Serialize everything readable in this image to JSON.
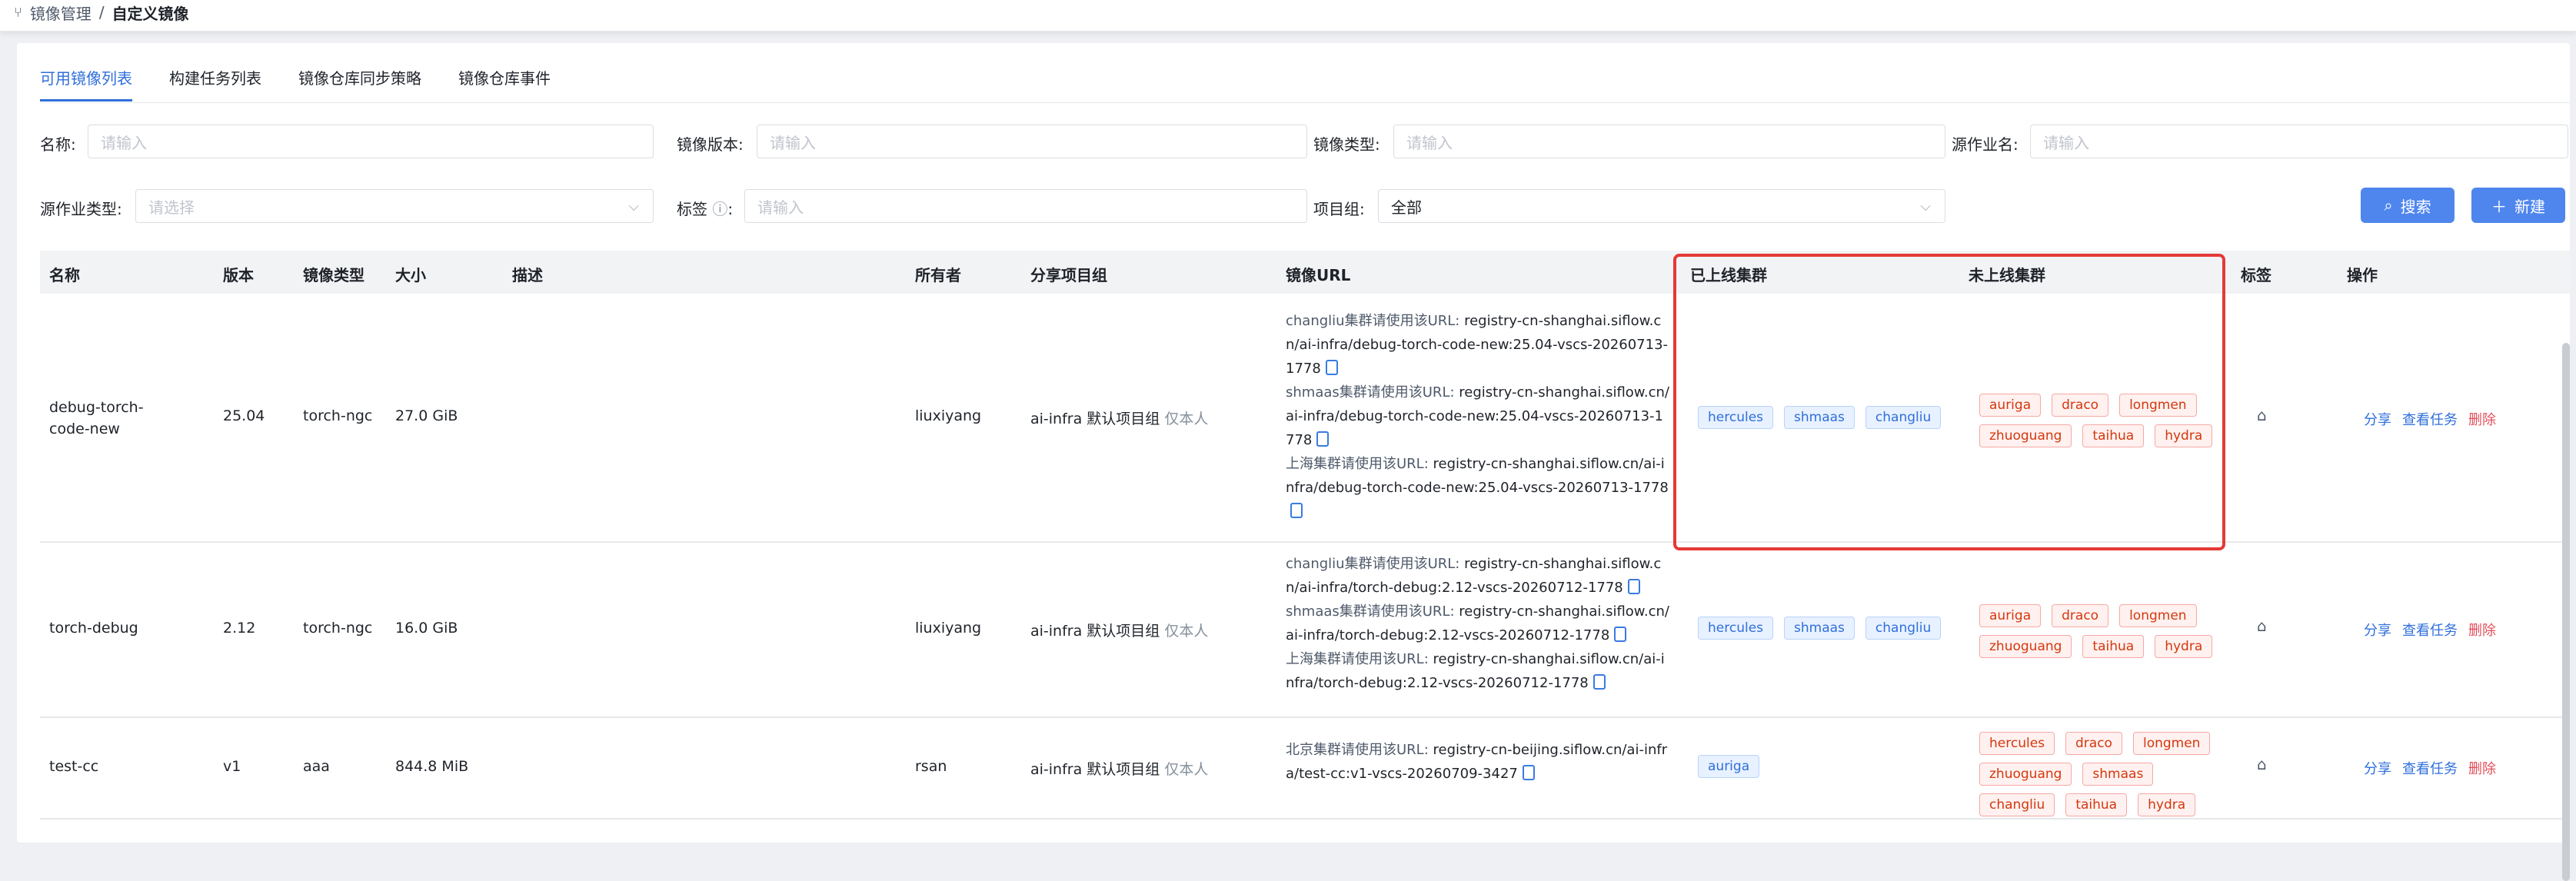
{
  "breadcrumb": {
    "parent": "镜像管理",
    "separator": "/",
    "current": "自定义镜像"
  },
  "tabs": [
    "可用镜像列表",
    "构建任务列表",
    "镜像仓库同步策略",
    "镜像仓库事件"
  ],
  "filters": {
    "name": {
      "label": "名称:",
      "placeholder": "请输入"
    },
    "version": {
      "label": "镜像版本:",
      "placeholder": "请输入"
    },
    "type": {
      "label": "镜像类型:",
      "placeholder": "请输入"
    },
    "source_job": {
      "label": "源作业名:",
      "placeholder": "请输入"
    },
    "source_job_type": {
      "label": "源作业类型:",
      "placeholder": "请选择"
    },
    "tag": {
      "label": "标签",
      "placeholder": "请输入"
    },
    "project": {
      "label": "项目组:",
      "value": "全部"
    }
  },
  "buttons": {
    "search": "搜索",
    "new": "新建"
  },
  "columns": [
    "名称",
    "版本",
    "镜像类型",
    "大小",
    "描述",
    "所有者",
    "分享项目组",
    "镜像URL",
    "已上线集群",
    "未上线集群",
    "标签",
    "操作"
  ],
  "rows": [
    {
      "name": "debug-torch-code-new",
      "version": "25.04",
      "type": "torch-ngc",
      "size": "27.0 GiB",
      "owner": "liuxiyang",
      "group": "ai-infra 默认项目组",
      "group_note": "仅本人",
      "urls": [
        {
          "prefix": "changliu集群请使用该URL:",
          "url": "registry-cn-shanghai.siflow.cn/ai-infra/debug-torch-code-new:25.04-vscs-20260713-1778"
        },
        {
          "prefix": "shmaas集群请使用该URL:",
          "url": "registry-cn-shanghai.siflow.cn/ai-infra/debug-torch-code-new:25.04-vscs-20260713-1778"
        },
        {
          "prefix": "上海集群请使用该URL:",
          "url": "registry-cn-shanghai.siflow.cn/ai-infra/debug-torch-code-new:25.04-vscs-20260713-1778"
        }
      ],
      "online": [
        "hercules",
        "shmaas",
        "changliu"
      ],
      "offline": [
        "auriga",
        "draco",
        "longmen",
        "zhuoguang",
        "taihua",
        "hydra"
      ]
    },
    {
      "name": "torch-debug",
      "version": "2.12",
      "type": "torch-ngc",
      "size": "16.0 GiB",
      "owner": "liuxiyang",
      "group": "ai-infra 默认项目组",
      "group_note": "仅本人",
      "urls": [
        {
          "prefix": "changliu集群请使用该URL:",
          "url": "registry-cn-shanghai.siflow.cn/ai-infra/torch-debug:2.12-vscs-20260712-1778"
        },
        {
          "prefix": "shmaas集群请使用该URL:",
          "url": "registry-cn-shanghai.siflow.cn/ai-infra/torch-debug:2.12-vscs-20260712-1778"
        },
        {
          "prefix": "上海集群请使用该URL:",
          "url": "registry-cn-shanghai.siflow.cn/ai-infra/torch-debug:2.12-vscs-20260712-1778"
        }
      ],
      "online": [
        "hercules",
        "shmaas",
        "changliu"
      ],
      "offline": [
        "auriga",
        "draco",
        "longmen",
        "zhuoguang",
        "taihua",
        "hydra"
      ]
    },
    {
      "name": "test-cc",
      "version": "v1",
      "type": "aaa",
      "size": "844.8 MiB",
      "owner": "rsan",
      "group": "ai-infra 默认项目组",
      "group_note": "仅本人",
      "urls": [
        {
          "prefix": "北京集群请使用该URL:",
          "url": "registry-cn-beijing.siflow.cn/ai-infra/test-cc:v1-vscs-20260709-3427"
        }
      ],
      "online": [
        "auriga"
      ],
      "offline": [
        "hercules",
        "draco",
        "longmen",
        "zhuoguang",
        "shmaas",
        "changliu",
        "taihua",
        "hydra"
      ]
    }
  ],
  "row_actions": {
    "share": "分享",
    "view_tasks": "查看任务",
    "delete": "删除"
  },
  "colors": {
    "primary": "#4f86ee",
    "highlight": "#e53935"
  }
}
